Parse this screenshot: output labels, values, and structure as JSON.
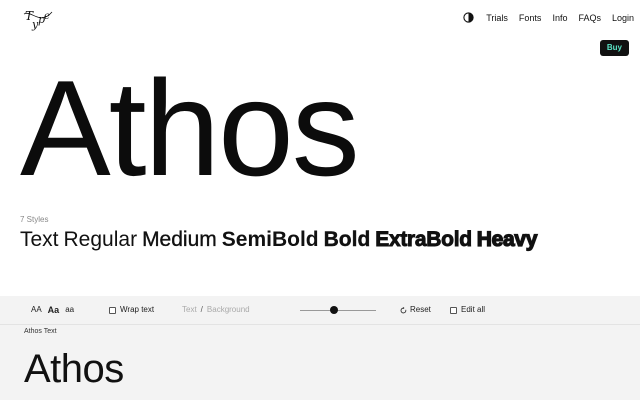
{
  "header": {
    "logo": "logo-icon",
    "nav": [
      {
        "label": "Trials"
      },
      {
        "label": "Fonts"
      },
      {
        "label": "Info"
      },
      {
        "label": "FAQs"
      },
      {
        "label": "Login"
      }
    ],
    "theme_icon": "contrast-icon",
    "buy_label": "Buy"
  },
  "hero": {
    "title": "Athos"
  },
  "styles": {
    "count": "7 Styles",
    "names": [
      "Text",
      "Regular",
      "Medium",
      "SemiBold",
      "Bold",
      "ExtraBold",
      "Heavy"
    ]
  },
  "toolbar": {
    "case_options": [
      "AA",
      "Aa",
      "aa"
    ],
    "case_selected": "Aa",
    "wrap_label": "Wrap text",
    "text_color_label": "Text",
    "separator": "/",
    "background_label": "Background",
    "size_slider_value": 0.45,
    "reset_label": "Reset",
    "reset_icon": "reset-icon",
    "edit_all_label": "Edit all"
  },
  "sample": {
    "label": "Athos Text",
    "text": "Athos"
  },
  "colors": {
    "buy_text": "#5be3c5",
    "buy_background": "#111111",
    "toolbar_background": "#f3f3f3"
  }
}
